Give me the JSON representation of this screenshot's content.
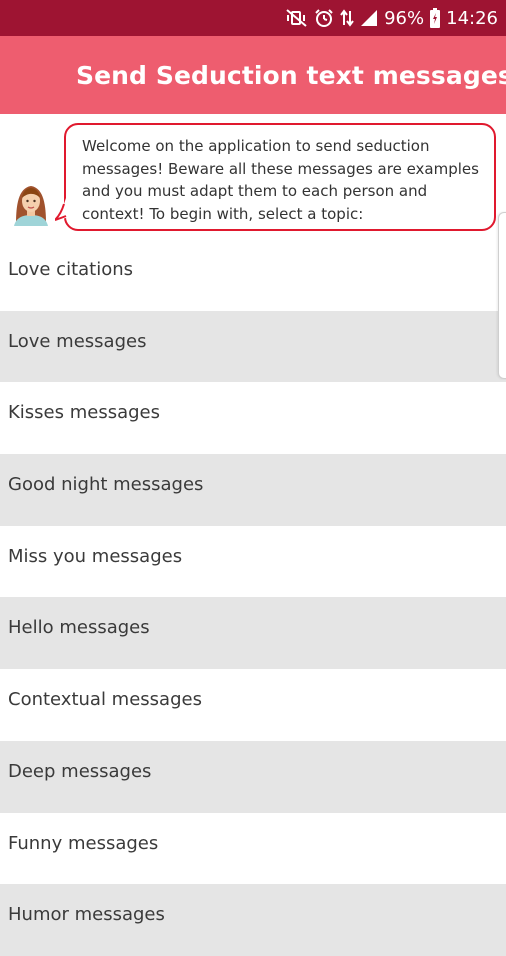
{
  "status_bar": {
    "battery": "96%",
    "time": "14:26",
    "icons": [
      "mute-vibrate-icon",
      "alarm-icon",
      "data-arrows-icon",
      "signal-icon",
      "battery-icon"
    ]
  },
  "app_bar": {
    "title": "Send Seduction text messages",
    "menu_icon": "hamburger-menu-icon"
  },
  "intro": {
    "message": "Welcome on the application to send seduction messages! Beware all these messages are examples and you must adapt them to each person and context! To begin with, select a topic:",
    "avatar_icon": "woman-avatar-icon"
  },
  "topics": [
    "Love citations",
    "Love messages",
    "Kisses messages",
    "Good night messages",
    "Miss you messages",
    "Hello messages",
    "Contextual messages",
    "Deep messages",
    "Funny messages",
    "Humor messages"
  ],
  "colors": {
    "status_bar": "#9e1432",
    "app_bar": "#ee5d6f",
    "bubble_border": "#e0192e",
    "row_alt": "#e5e5e5"
  }
}
